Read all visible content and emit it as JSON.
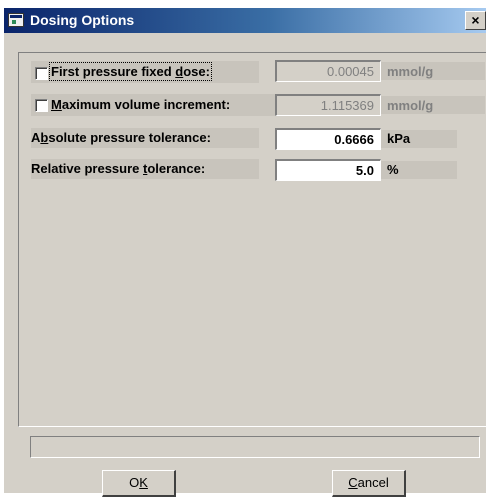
{
  "window": {
    "title": "Dosing Options",
    "close_label": "×"
  },
  "options": {
    "first_dose": {
      "label_pre": "First pressure fixed ",
      "label_u": "d",
      "label_post": "ose:",
      "checked": false,
      "value": "0.00045",
      "unit": "mmol/g"
    },
    "max_volume": {
      "label_pre": "",
      "label_u": "M",
      "label_post": "aximum volume increment:",
      "checked": false,
      "value": "1.115369",
      "unit": "mmol/g"
    },
    "abs_tolerance": {
      "label_pre": "A",
      "label_u": "b",
      "label_post": "solute pressure tolerance:",
      "value": "0.6666",
      "unit": "kPa"
    },
    "rel_tolerance": {
      "label_pre": "Relative pressure ",
      "label_u": "t",
      "label_post": "olerance:",
      "value": "5.0",
      "unit": "%"
    }
  },
  "status_text": "",
  "buttons": {
    "ok": {
      "pre": "O",
      "u": "K",
      "post": ""
    },
    "cancel": {
      "pre": "",
      "u": "C",
      "post": "ancel"
    }
  }
}
